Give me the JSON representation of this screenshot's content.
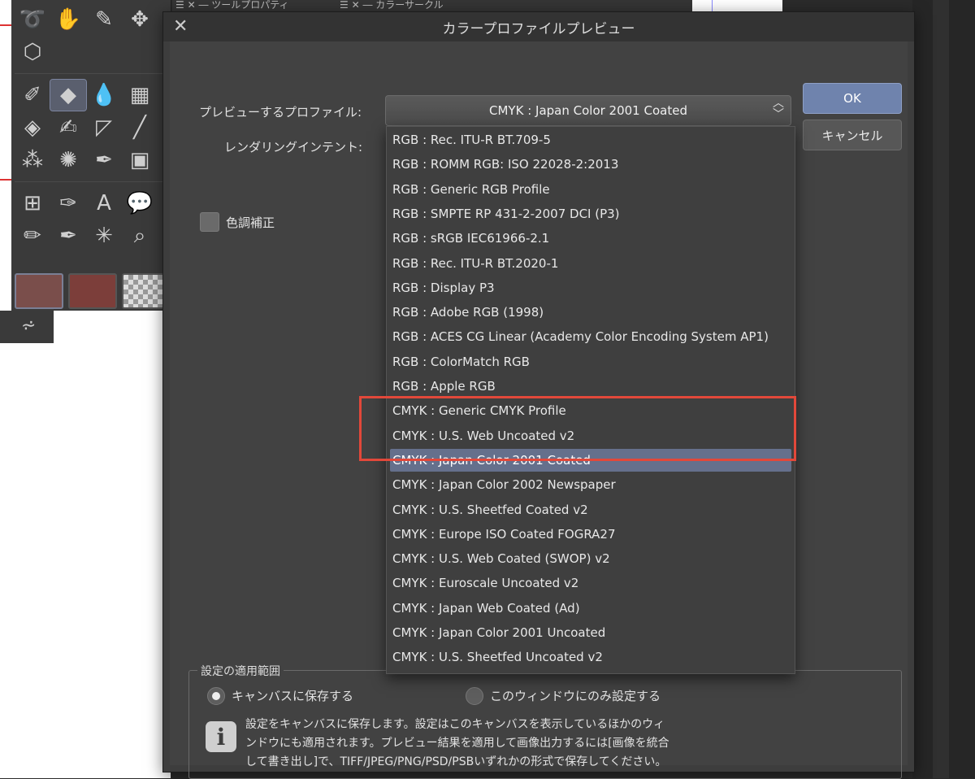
{
  "background": {
    "top_tabs": [
      "ツールプロパティ",
      "カラーサークル"
    ]
  },
  "dialog": {
    "title": "カラープロファイルプレビュー",
    "preview_profile_label": "プレビューするプロファイル:",
    "rendering_intent_label": "レンダリングインテント:",
    "selected_profile": "CMYK : Japan Color 2001 Coated",
    "ok_label": "OK",
    "cancel_label": "キャンセル",
    "tone_correction_label": "色調補正",
    "profiles": [
      "RGB : Rec. ITU-R BT.709-5",
      "RGB : ROMM RGB: ISO 22028-2:2013",
      "RGB : Generic RGB Profile",
      "RGB : SMPTE RP 431-2-2007 DCI (P3)",
      "RGB : sRGB IEC61966-2.1",
      "RGB : Rec. ITU-R BT.2020-1",
      "RGB : Display P3",
      "RGB : Adobe RGB (1998)",
      "RGB : ACES CG Linear (Academy Color Encoding System AP1)",
      "RGB : ColorMatch RGB",
      "RGB : Apple RGB",
      "CMYK : Generic CMYK Profile",
      "CMYK : U.S. Web Uncoated v2",
      "CMYK : Japan Color 2001 Coated",
      "CMYK : Japan Color 2002 Newspaper",
      "CMYK : U.S. Sheetfed Coated v2",
      "CMYK : Europe ISO Coated FOGRA27",
      "CMYK : U.S. Web Coated (SWOP) v2",
      "CMYK : Euroscale Uncoated v2",
      "CMYK : Japan Web Coated (Ad)",
      "CMYK : Japan Color 2001 Uncoated",
      "CMYK : U.S. Sheetfed Uncoated v2"
    ],
    "selected_index": 13,
    "scope": {
      "title": "設定の適用範囲",
      "option_canvas": "キャンバスに保存する",
      "option_window": "このウィンドウにのみ設定する",
      "selected": "canvas",
      "info_lines": [
        "設定をキャンバスに保存します。設定はこのキャンバスを表示しているほかのウィ",
        "ンドウにも適用されます。プレビュー結果を適用して画像出力するには[画像を統合",
        "して書き出し]で、TIFF/JPEG/PNG/PSD/PSBいずれかの形式で保存してください。"
      ]
    }
  },
  "colors": {
    "accent": "#6f83ad",
    "highlight_box": "#e2483a"
  }
}
